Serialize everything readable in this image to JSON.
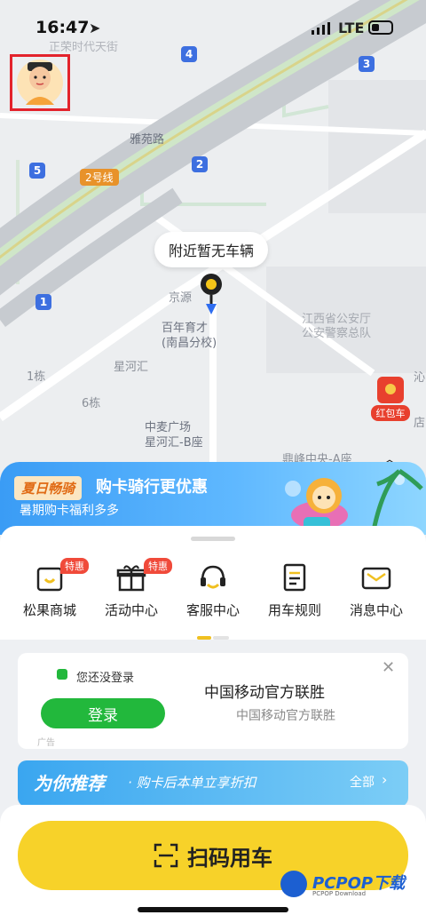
{
  "status_bar": {
    "time": "16:47",
    "network": "LTE"
  },
  "map": {
    "labels": {
      "yayuan_road_top": "雅苑路",
      "yayuan_road": "雅苑路",
      "jingyuan": "京源",
      "school_line1": "百年育才",
      "school_line2": "(南昌分校)",
      "xinghe": "星河汇",
      "bldg1": "1栋",
      "bldg6": "6栋",
      "zhongmai_line1": "中麦广场",
      "zhongmai_line2": "星河汇-B座",
      "dingfeng": "鼎峰中央-A座",
      "police_line1": "江西省公安厅",
      "police_line2": "公安警察总队",
      "top_faded": "正荣时代天街",
      "right_edge1": "沁",
      "right_edge2": "店"
    },
    "metro_exits": [
      "4",
      "3",
      "5",
      "2",
      "1"
    ],
    "line_badge": "2号线",
    "nearby_bubble": "附近暂无车辆",
    "red_packet_label": "红包车"
  },
  "banner": {
    "tag": "夏日畅骑",
    "title": "购卡骑行更优惠",
    "subtitle": "暑期购卡福利多多"
  },
  "quick_menu": [
    {
      "label": "松果商城",
      "icon": "bag-icon",
      "tag": "特惠"
    },
    {
      "label": "活动中心",
      "icon": "gift-icon",
      "tag": "特惠"
    },
    {
      "label": "客服中心",
      "icon": "headset-icon",
      "tag": ""
    },
    {
      "label": "用车规则",
      "icon": "document-icon",
      "tag": ""
    },
    {
      "label": "消息中心",
      "icon": "mail-icon",
      "tag": ""
    }
  ],
  "ad": {
    "not_logged_in": "您还没登录",
    "login_button": "登录",
    "title": "中国移动官方联胜",
    "subtitle": "中国移动官方联胜",
    "ad_mark": "广告"
  },
  "recommend": {
    "title": "为你推荐",
    "subtitle": "· 购卡后本单立享折扣",
    "all": "全部"
  },
  "scan_button": {
    "label": "扫码用车"
  },
  "watermark": {
    "brand": "PCPOP下载",
    "sub": "PCPOP Download"
  }
}
